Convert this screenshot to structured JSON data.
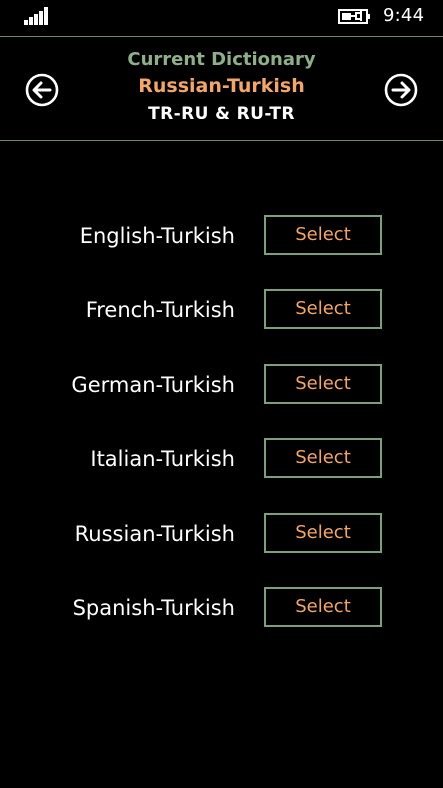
{
  "status_bar": {
    "time": "9:44",
    "signal_icon": "signal-strength-icon",
    "battery_icon": "battery-charging-icon"
  },
  "header": {
    "caption": "Current Dictionary",
    "current_dictionary": "Russian-Turkish",
    "language_codes": "TR-RU & RU-TR",
    "back_icon": "arrow-left-circle-icon",
    "forward_icon": "arrow-right-circle-icon"
  },
  "dictionaries": [
    {
      "label": "English-Turkish",
      "button": "Select"
    },
    {
      "label": "French-Turkish",
      "button": "Select"
    },
    {
      "label": "German-Turkish",
      "button": "Select"
    },
    {
      "label": "Italian-Turkish",
      "button": "Select"
    },
    {
      "label": "Russian-Turkish",
      "button": "Select"
    },
    {
      "label": "Spanish-Turkish",
      "button": "Select"
    }
  ],
  "colors": {
    "background": "#000000",
    "caption_green": "#8fae8a",
    "accent_orange": "#f2a66c",
    "button_border": "#7f9f7c",
    "rule_line": "#6e8a6e"
  }
}
